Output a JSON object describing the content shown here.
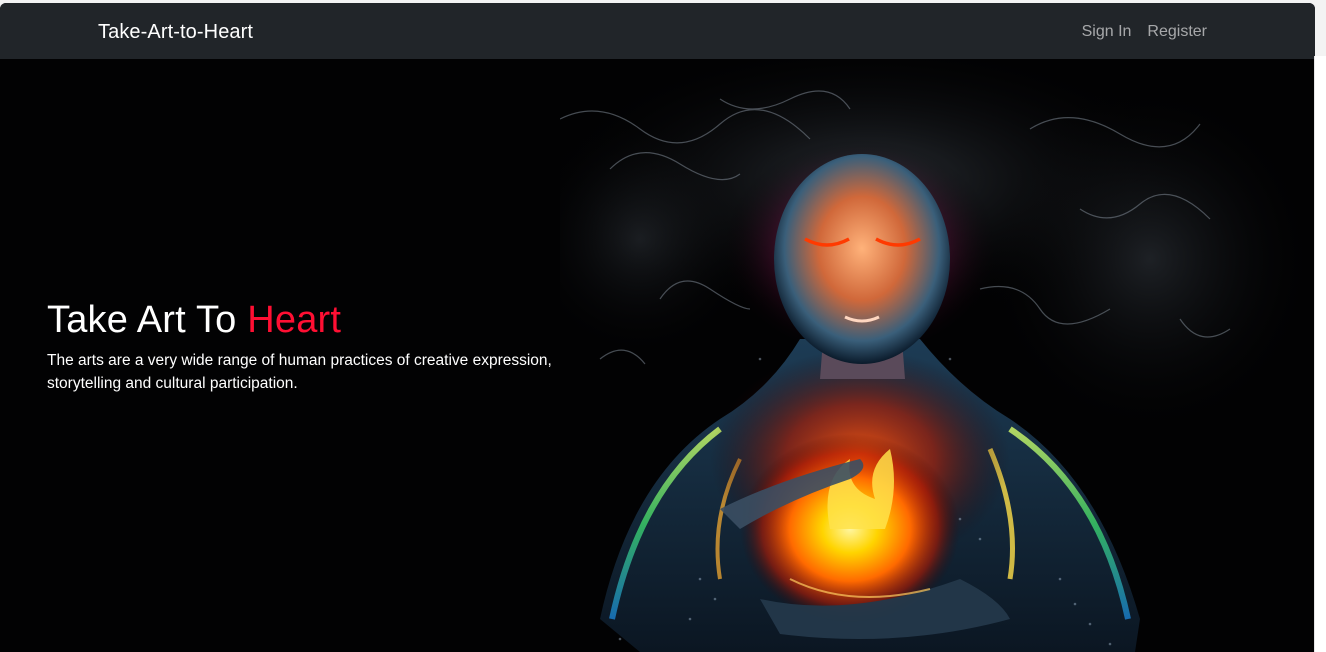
{
  "navbar": {
    "brand": "Take-Art-to-Heart",
    "links": [
      {
        "label": "Sign In"
      },
      {
        "label": "Register"
      }
    ]
  },
  "hero": {
    "title_main": "Take Art To ",
    "title_accent": "Heart",
    "subtitle_line1": "The arts are a very wide range of human practices of creative expression,",
    "subtitle_line2": "storytelling and cultural participation.",
    "image": "glowing-woman-holding-fire-artwork"
  },
  "colors": {
    "navbar_bg": "#212529",
    "accent": "#ff0f33",
    "hero_bg": "#020203"
  }
}
